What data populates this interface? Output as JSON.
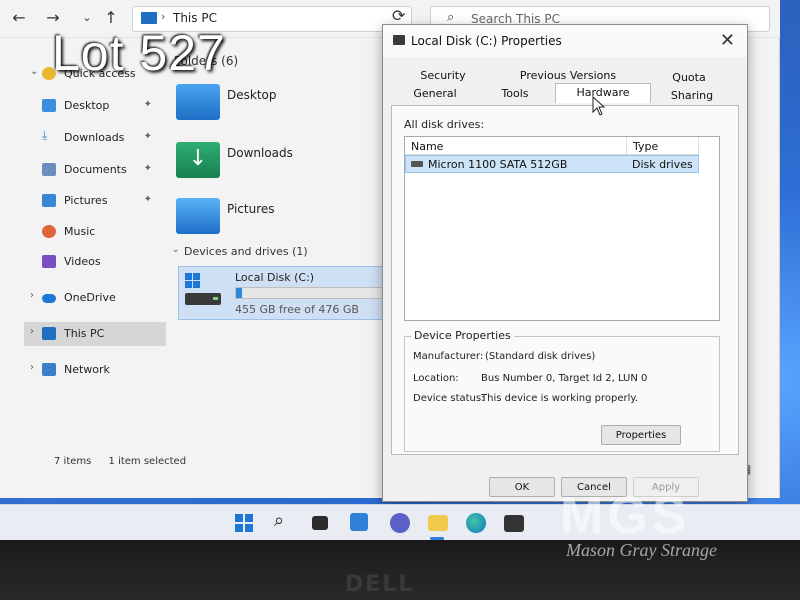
{
  "overlay": {
    "lot_label": "Lot 527"
  },
  "explorer": {
    "address": "This PC",
    "search_placeholder": "Search This PC",
    "sidebar": [
      {
        "label": "Quick access",
        "icon": "star-icon",
        "pinned": false
      },
      {
        "label": "Desktop",
        "icon": "desktop-icon",
        "pinned": true
      },
      {
        "label": "Downloads",
        "icon": "download-icon",
        "pinned": true
      },
      {
        "label": "Documents",
        "icon": "document-icon",
        "pinned": true
      },
      {
        "label": "Pictures",
        "icon": "picture-icon",
        "pinned": true
      },
      {
        "label": "Music",
        "icon": "music-icon",
        "pinned": false
      },
      {
        "label": "Videos",
        "icon": "video-icon",
        "pinned": false
      },
      {
        "label": "OneDrive",
        "icon": "cloud-icon",
        "pinned": false
      },
      {
        "label": "This PC",
        "icon": "pc-icon",
        "pinned": false
      },
      {
        "label": "Network",
        "icon": "network-icon",
        "pinned": false
      }
    ],
    "folders_header": "Folders (6)",
    "folders": [
      "Desktop",
      "Downloads",
      "Pictures"
    ],
    "devices_header": "Devices and drives (1)",
    "drive": {
      "name": "Local Disk (C:)",
      "free_text": "455 GB free of 476 GB",
      "used_fraction": 0.044
    },
    "status": {
      "items": "7 items",
      "selected": "1 item selected"
    }
  },
  "dialog": {
    "title": "Local Disk (C:) Properties",
    "tabs_top": [
      "Security",
      "Previous Versions",
      "Quota"
    ],
    "tabs_bottom": [
      "General",
      "Tools",
      "Hardware",
      "Sharing"
    ],
    "active_tab": "Hardware",
    "all_disk_drives_label": "All disk drives:",
    "columns": [
      "Name",
      "Type"
    ],
    "drives": [
      {
        "name": "Micron 1100 SATA 512GB",
        "type": "Disk drives"
      }
    ],
    "device_properties": {
      "title": "Device Properties",
      "manufacturer_label": "Manufacturer:",
      "manufacturer_value": "(Standard disk drives)",
      "location_label": "Location:",
      "location_value": "Bus Number 0, Target Id 2, LUN 0",
      "status_label": "Device status:",
      "status_value": "This device is working properly."
    },
    "buttons": {
      "properties": "Properties",
      "ok": "OK",
      "cancel": "Cancel",
      "apply": "Apply"
    }
  },
  "watermark": {
    "logo": "MGS",
    "subtitle": "Mason Gray Strange"
  },
  "bezel": {
    "brand": "DELL"
  },
  "colors": {
    "accent": "#2b88d8",
    "selection": "#cde3f7",
    "taskbar_active": "#2f7de0"
  }
}
